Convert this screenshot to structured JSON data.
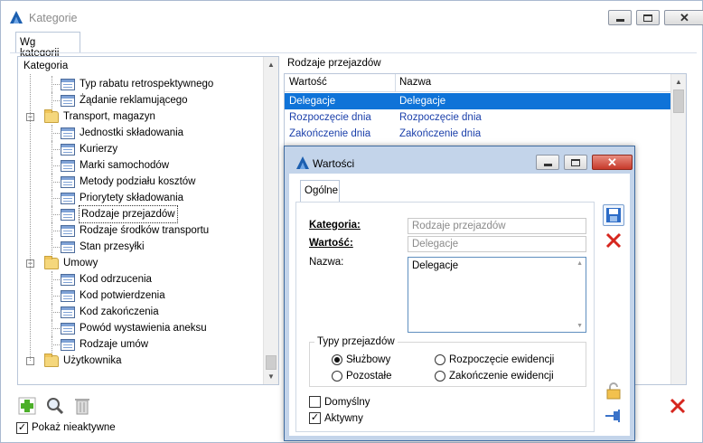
{
  "window": {
    "title": "Kategorie"
  },
  "tabs": {
    "main": "Wg kategorii"
  },
  "tree": {
    "header": "Kategoria",
    "items": [
      {
        "label": "Typ rabatu retrospektywnego",
        "kind": "leaf"
      },
      {
        "label": "Żądanie reklamującego",
        "kind": "leaf"
      },
      {
        "label": "Transport, magazyn",
        "kind": "folder",
        "expander": "−"
      },
      {
        "label": "Jednostki składowania",
        "kind": "leaf"
      },
      {
        "label": "Kurierzy",
        "kind": "leaf"
      },
      {
        "label": "Marki samochodów",
        "kind": "leaf"
      },
      {
        "label": "Metody podziału kosztów",
        "kind": "leaf"
      },
      {
        "label": "Priorytety składowania",
        "kind": "leaf"
      },
      {
        "label": "Rodzaje przejazdów",
        "kind": "leaf",
        "selected": true
      },
      {
        "label": "Rodzaje środków transportu",
        "kind": "leaf"
      },
      {
        "label": "Stan przesyłki",
        "kind": "leaf"
      },
      {
        "label": "Umowy",
        "kind": "folder",
        "expander": "−"
      },
      {
        "label": "Kod odrzucenia",
        "kind": "leaf"
      },
      {
        "label": "Kod potwierdzenia",
        "kind": "leaf"
      },
      {
        "label": "Kod zakończenia",
        "kind": "leaf"
      },
      {
        "label": "Powód wystawienia aneksu",
        "kind": "leaf"
      },
      {
        "label": "Rodzaje umów",
        "kind": "leaf"
      },
      {
        "label": "Użytkownika",
        "kind": "folder"
      }
    ]
  },
  "grid": {
    "title": "Rodzaje przejazdów",
    "columns": [
      "Wartość",
      "Nazwa"
    ],
    "rows": [
      {
        "value": "Delegacje",
        "name": "Delegacje",
        "selected": true
      },
      {
        "value": "Rozpoczęcie dnia",
        "name": "Rozpoczęcie dnia"
      },
      {
        "value": "Zakończenie dnia",
        "name": "Zakończenie dnia"
      }
    ]
  },
  "footer": {
    "show_inactive_label": "Pokaż nieaktywne",
    "show_inactive_checked": true
  },
  "dialog": {
    "title": "Wartości",
    "tab": "Ogólne",
    "kategoria_label": "Kategoria:",
    "kategoria_value": "Rodzaje przejazdów",
    "wartosc_label": "Wartość:",
    "wartosc_value": "Delegacje",
    "nazwa_label": "Nazwa:",
    "nazwa_value": "Delegacje",
    "group_title": "Typy przejazdów",
    "radios": [
      {
        "label": "Służbowy",
        "checked": true
      },
      {
        "label": "Pozostałe",
        "checked": false
      },
      {
        "label": "Rozpoczęcie ewidencji",
        "checked": false
      },
      {
        "label": "Zakończenie ewidencji",
        "checked": false
      }
    ],
    "default_label": "Domyślny",
    "default_checked": false,
    "active_label": "Aktywny",
    "active_checked": true
  },
  "icons": {
    "app": "app-logo-icon",
    "add": "add-plus-icon",
    "search": "magnifier-icon",
    "delete": "trash-icon",
    "save": "save-disk-icon",
    "cancel": "red-x-icon",
    "lock": "padlock-icon",
    "pin": "pin-icon"
  },
  "colors": {
    "selection": "#0f73d8",
    "link_text": "#1a3faa",
    "folder": "#f5d77c",
    "dialog_frame": "#c3d4ea"
  }
}
